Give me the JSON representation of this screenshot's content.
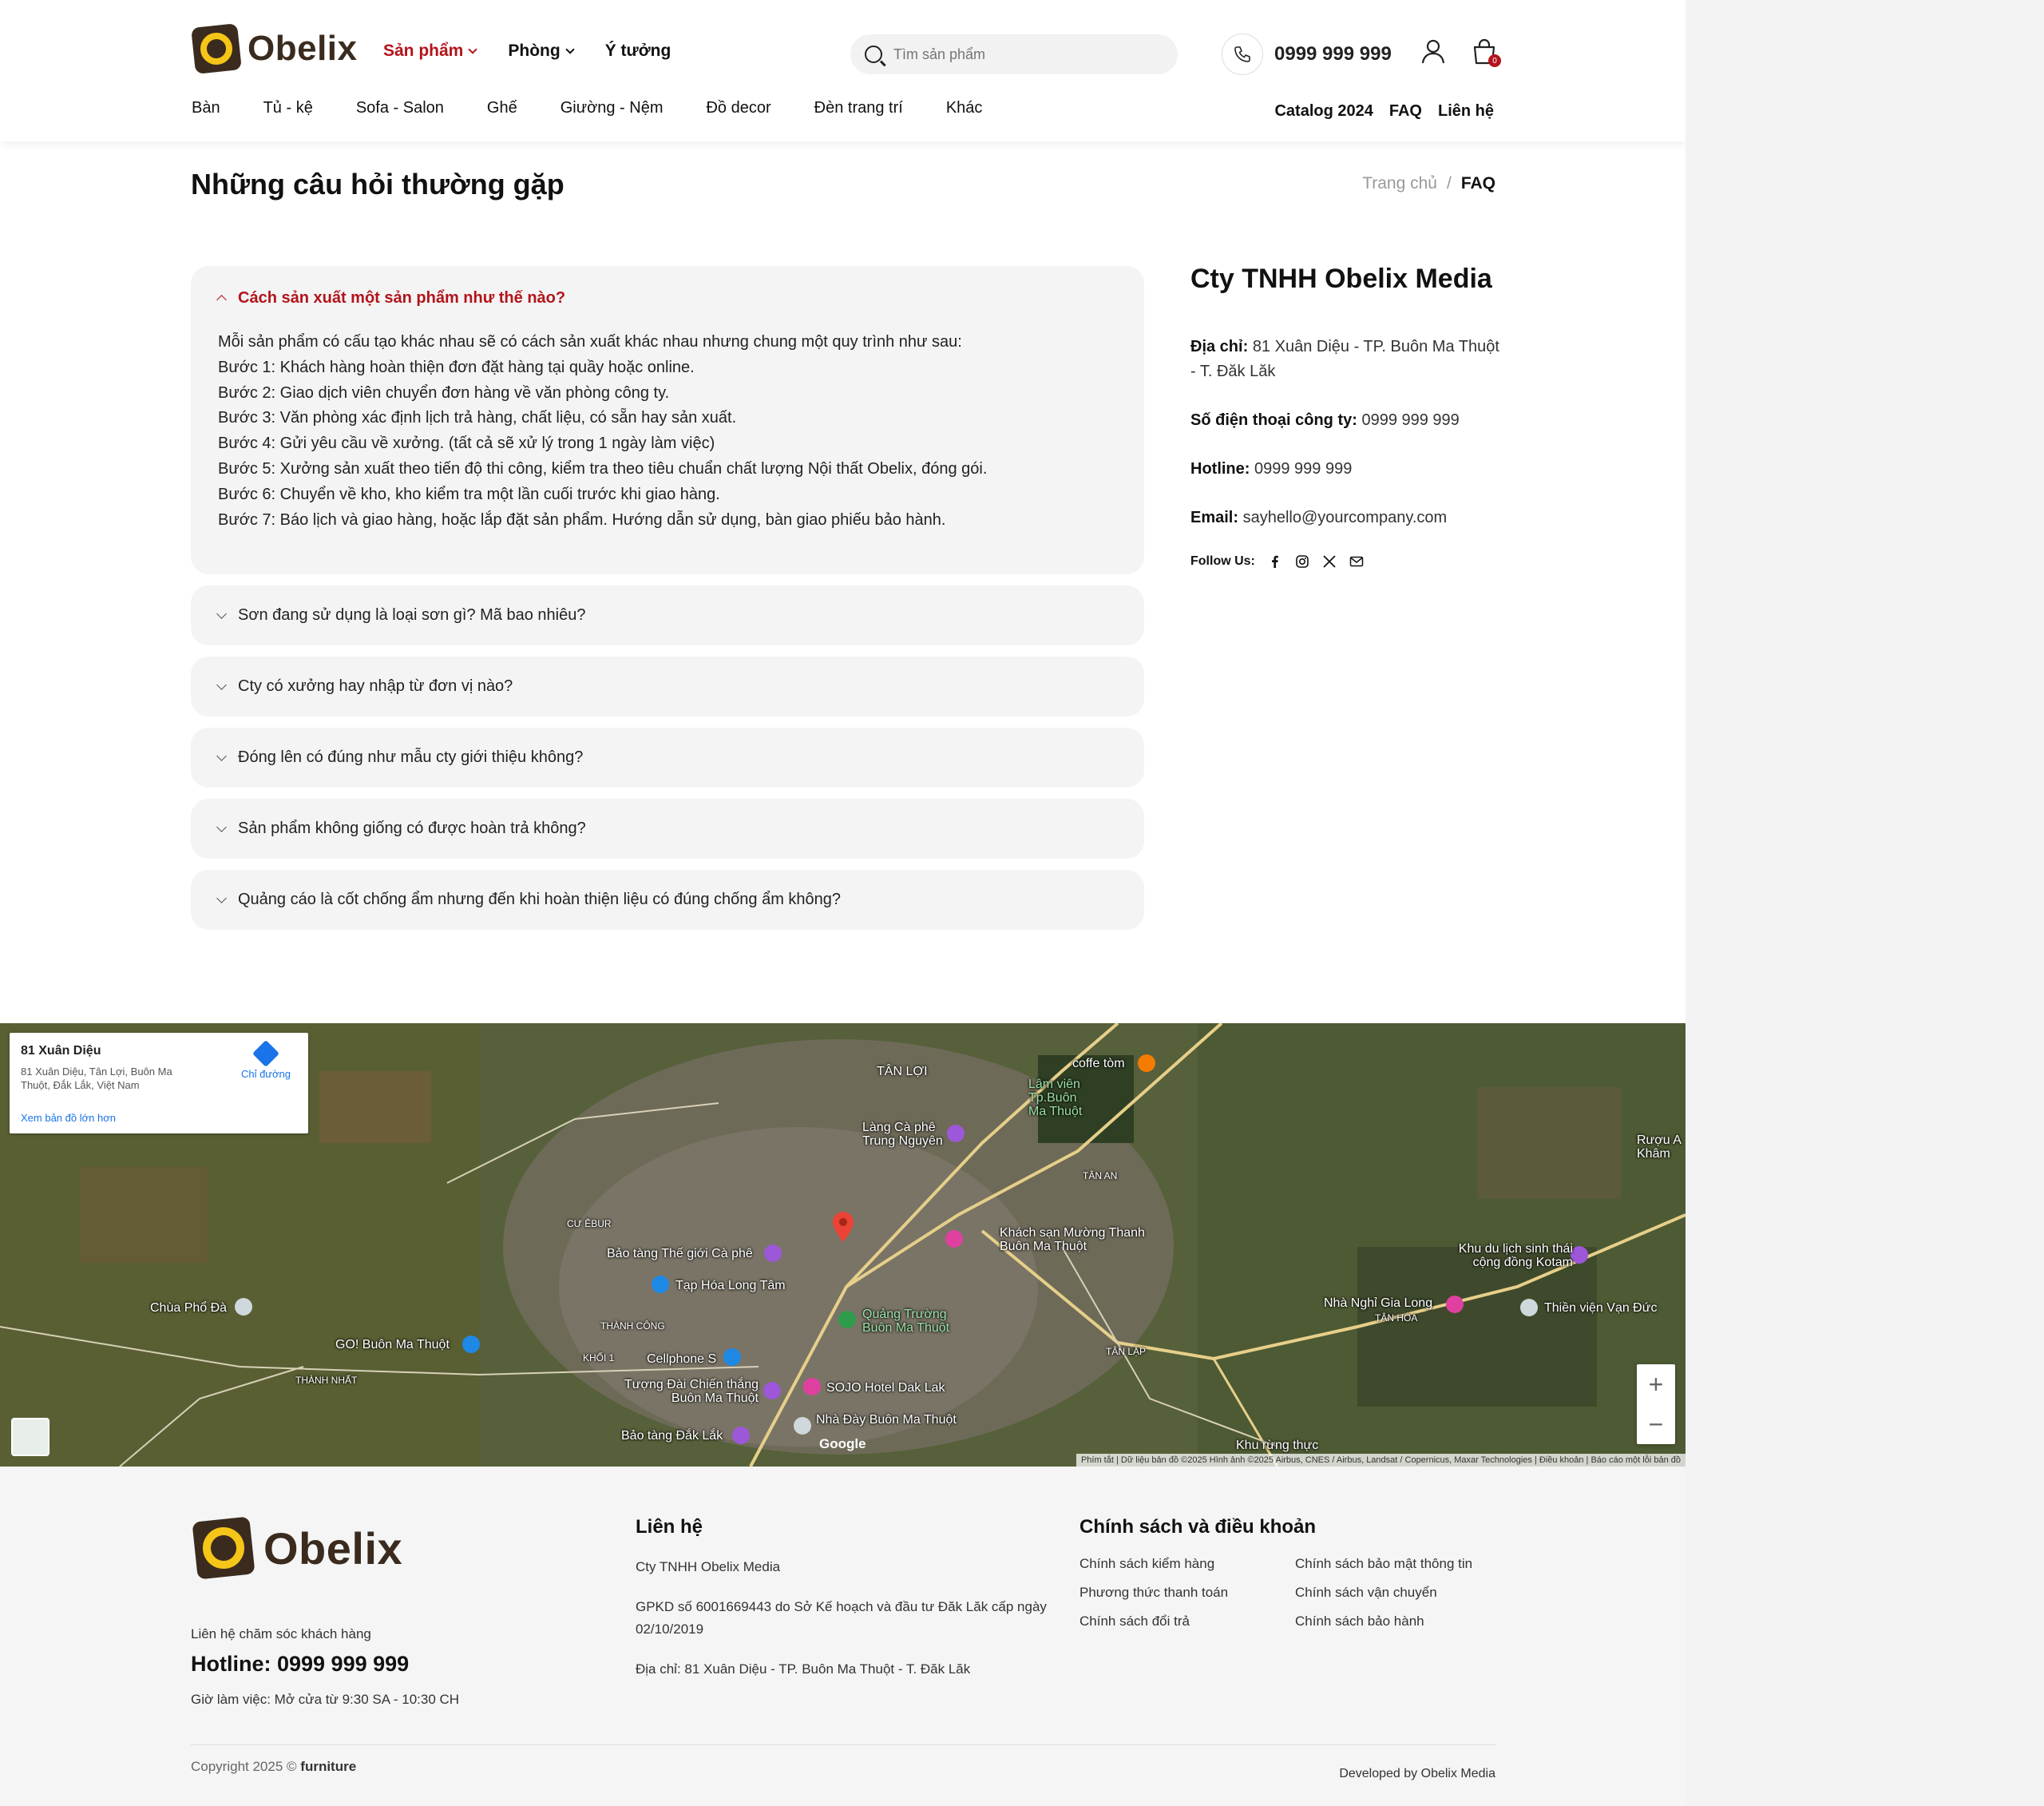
{
  "header": {
    "logo_text": "Obelix",
    "main_nav": [
      {
        "label": "Sản phẩm",
        "has_dropdown": true,
        "active": true
      },
      {
        "label": "Phòng",
        "has_dropdown": true,
        "active": false
      },
      {
        "label": "Ý tưởng",
        "has_dropdown": false,
        "active": false
      }
    ],
    "search_placeholder": "Tìm sản phẩm",
    "phone": "0999 999 999",
    "cart_count": "0",
    "categories": [
      "Bàn",
      "Tủ - kệ",
      "Sofa - Salon",
      "Ghế",
      "Giường - Nệm",
      "Đồ decor",
      "Đèn trang trí",
      "Khác"
    ],
    "util_links": [
      "Catalog 2024",
      "FAQ",
      "Liên hệ"
    ]
  },
  "page": {
    "title": "Những câu hỏi thường gặp",
    "breadcrumb": {
      "home": "Trang chủ",
      "separator": "/",
      "current": "FAQ"
    }
  },
  "faq": {
    "open": {
      "question": "Cách sản xuất một sản phẩm như thế nào?",
      "answer_lines": [
        "Mỗi sản phẩm có cấu tạo khác nhau sẽ có cách sản xuất khác nhau nhưng chung một quy trình như sau:",
        "Bước 1: Khách hàng hoàn thiện đơn đặt hàng tại quầy hoặc online.",
        "Bước 2: Giao dịch viên chuyển đơn hàng về văn phòng công ty.",
        "Bước 3: Văn phòng xác định lịch trả hàng, chất liệu, có sẵn hay sản xuất.",
        "Bước 4: Gửi yêu cầu về xưởng. (tất cả sẽ xử lý trong 1 ngày làm việc)",
        "Bước 5: Xưởng sản xuất theo tiến độ thi công, kiểm tra theo tiêu chuẩn chất lượng Nội thất Obelix, đóng gói.",
        "Bước 6: Chuyển về kho, kho kiểm tra một lần cuối trước khi giao hàng.",
        "Bước 7: Báo lịch và giao hàng, hoặc lắp đặt sản phẩm. Hướng dẫn sử dụng, bàn giao phiếu bảo hành."
      ]
    },
    "closed": [
      "Sơn đang sử dụng là loại sơn gì? Mã bao nhiêu?",
      "Cty có xưởng hay nhập từ đơn vị nào?",
      "Đóng lên có đúng như mẫu cty giới thiệu không?",
      "Sản phẩm không giống có được hoàn trả không?",
      "Quảng cáo là cốt chống ẩm nhưng đến khi hoàn thiện liệu có đúng chống ẩm không?"
    ]
  },
  "contact": {
    "company": "Cty TNHH Obelix Media",
    "address_label": "Địa chỉ:",
    "address": "81 Xuân Diệu - TP. Buôn Ma Thuột - T. Đăk Lăk",
    "company_phone_label": "Số điện thoại công ty:",
    "company_phone": "0999 999 999",
    "hotline_label": "Hotline:",
    "hotline": "0999 999 999",
    "email_label": "Email:",
    "email": "sayhello@yourcompany.com",
    "follow_label": "Follow Us:",
    "socials": [
      "facebook-icon",
      "instagram-icon",
      "x-icon",
      "email-icon"
    ]
  },
  "map": {
    "card_title": "81 Xuân Diệu",
    "card_address": "81 Xuân Diệu, Tân Lợi, Buôn Ma Thuột, Đắk Lắk, Việt Nam",
    "directions": "Chỉ đường",
    "larger_map": "Xem bản đồ lớn hơn",
    "zoom_in": "+",
    "zoom_out": "−",
    "google": "Google",
    "attribution": "Phím tắt | Dữ liệu bản đồ ©2025 Hình ảnh ©2025 Airbus, CNES / Airbus, Landsat / Copernicus, Maxar Technologies | Điều khoản | Báo cáo một lỗi bản đồ",
    "labels": [
      "TÂN LỢI",
      "coffe tòm",
      "Lâm viên Tp.Buôn Ma Thuột",
      "Làng Cà phê Trung Nguyên",
      "Bảo tàng Thế giới Cà phê",
      "Tạp Hóa Long Tâm",
      "Khách sạn Mường Thanh Buôn Ma Thuột",
      "Quảng Trường Buôn Ma Thuột",
      "Chùa Phổ Đà",
      "GO! Buôn Ma Thuột",
      "Cellphone S",
      "SOJO Hotel Dak Lak",
      "Tượng Đài Chiến thắng Buôn Ma Thuột",
      "Nhà Đày Buôn Ma Thuột",
      "Bảo tàng Đắk Lắk",
      "Khu du lịch sinh thái cộng đồng Kotam",
      "Nhà Nghỉ Gia Long",
      "Thiền viện Vạn Đức",
      "TÂN HÒA",
      "TÂN LẬP",
      "THÀNH CÔNG",
      "KHỐI 1",
      "THÀNH NHẤT",
      "Khu rừng thực",
      "Rượu A Khâm",
      "CƯ ÊBUR",
      "TÂN AN"
    ]
  },
  "footer": {
    "logo_text": "Obelix",
    "care_label": "Liên hệ chăm sóc khách hàng",
    "hotline": "Hotline: 0999 999 999",
    "hours": "Giờ làm việc: Mở cửa từ 9:30 SA - 10:30 CH",
    "contact_title": "Liên hệ",
    "contact_lines": [
      "Cty TNHH Obelix Media",
      "GPKD số 6001669443 do Sở Kế hoạch và đầu tư Đăk Lăk cấp ngày 02/10/2019",
      "Địa chỉ: 81 Xuân Diệu - TP. Buôn Ma Thuột - T. Đăk Lăk"
    ],
    "policy_title": "Chính sách và điều khoản",
    "policies": [
      "Chính sách kiểm hàng",
      "Chính sách bảo mật thông tin",
      "Phương thức thanh toán",
      "Chính sách vận chuyển",
      "Chính sách đổi trả",
      "Chính sách bảo hành"
    ],
    "copyright_prefix": "Copyright 2025 ©",
    "copyright_brand": "furniture",
    "developer": "Developed by Obelix Media"
  },
  "colors": {
    "accent": "#b2141b",
    "logo_yellow": "#f5c518",
    "logo_brown": "#3a2b1e"
  }
}
